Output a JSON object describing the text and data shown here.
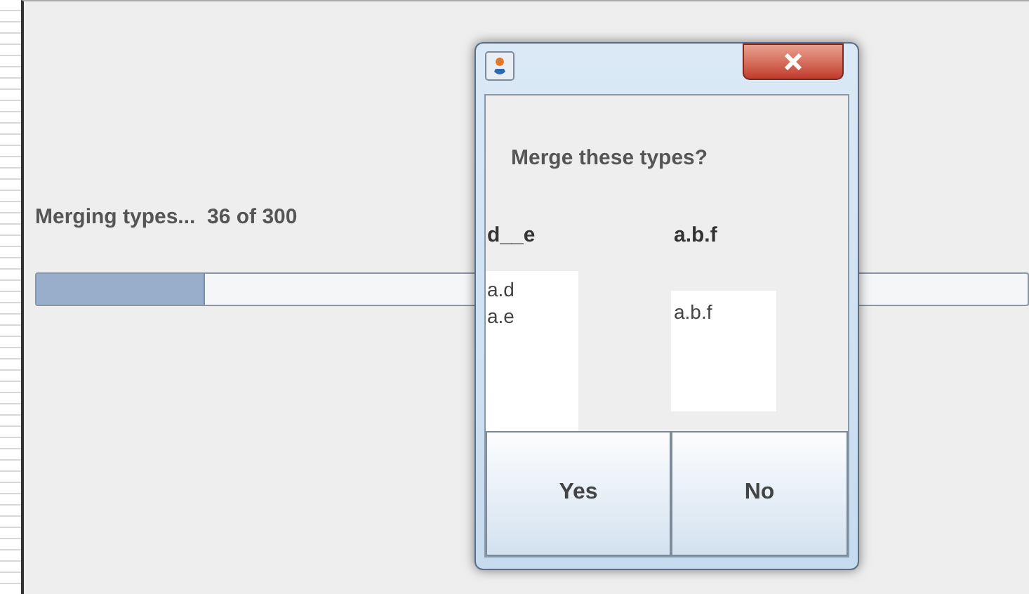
{
  "progress": {
    "label": "Merging types...  36 of 300",
    "level": 0.17
  },
  "dialog": {
    "question": "Merge these types?",
    "columns": [
      {
        "heading": "d__e",
        "items": [
          "a.d",
          "a.e"
        ]
      },
      {
        "heading": "a.b.f",
        "items": [
          "a.b.f"
        ]
      }
    ],
    "buttons": [
      "Yes",
      "No"
    ]
  }
}
